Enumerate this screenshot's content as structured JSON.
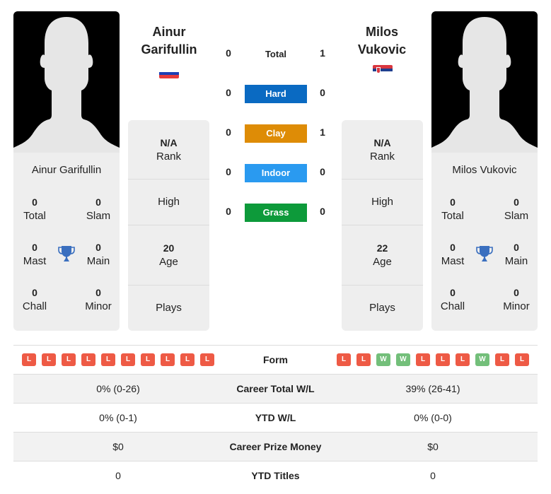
{
  "players": {
    "left": {
      "name_line1": "Ainur",
      "name_line2": "Garifullin",
      "full_name": "Ainur Garifullin",
      "flag": "russia-flag",
      "titles": {
        "total": {
          "value": "0",
          "label": "Total"
        },
        "slam": {
          "value": "0",
          "label": "Slam"
        },
        "mast": {
          "value": "0",
          "label": "Mast"
        },
        "main": {
          "value": "0",
          "label": "Main"
        },
        "chall": {
          "value": "0",
          "label": "Chall"
        },
        "minor": {
          "value": "0",
          "label": "Minor"
        }
      },
      "info": {
        "rank": {
          "value": "N/A",
          "label": "Rank"
        },
        "high": {
          "value": "",
          "label": "High"
        },
        "age": {
          "value": "20",
          "label": "Age"
        },
        "plays": {
          "value": "",
          "label": "Plays"
        }
      },
      "form": [
        "L",
        "L",
        "L",
        "L",
        "L",
        "L",
        "L",
        "L",
        "L",
        "L"
      ]
    },
    "right": {
      "name_line1": "Milos",
      "name_line2": "Vukovic",
      "full_name": "Milos Vukovic",
      "flag": "serbia-flag",
      "titles": {
        "total": {
          "value": "0",
          "label": "Total"
        },
        "slam": {
          "value": "0",
          "label": "Slam"
        },
        "mast": {
          "value": "0",
          "label": "Mast"
        },
        "main": {
          "value": "0",
          "label": "Main"
        },
        "chall": {
          "value": "0",
          "label": "Chall"
        },
        "minor": {
          "value": "0",
          "label": "Minor"
        }
      },
      "info": {
        "rank": {
          "value": "N/A",
          "label": "Rank"
        },
        "high": {
          "value": "",
          "label": "High"
        },
        "age": {
          "value": "22",
          "label": "Age"
        },
        "plays": {
          "value": "",
          "label": "Plays"
        }
      },
      "form": [
        "L",
        "L",
        "W",
        "W",
        "L",
        "L",
        "L",
        "W",
        "L",
        "L"
      ]
    }
  },
  "h2h": {
    "total": {
      "label": "Total",
      "left": "0",
      "right": "1"
    },
    "surfaces": [
      {
        "label": "Hard",
        "left": "0",
        "right": "0",
        "color": "#0a6ac2"
      },
      {
        "label": "Clay",
        "left": "0",
        "right": "1",
        "color": "#de8c06"
      },
      {
        "label": "Indoor",
        "left": "0",
        "right": "0",
        "color": "#2a9af0"
      },
      {
        "label": "Grass",
        "left": "0",
        "right": "0",
        "color": "#0d9a3a"
      }
    ]
  },
  "table": {
    "form_label": "Form",
    "rows": [
      {
        "label": "Career Total W/L",
        "left": "0% (0-26)",
        "right": "39% (26-41)"
      },
      {
        "label": "YTD W/L",
        "left": "0% (0-1)",
        "right": "0% (0-0)"
      },
      {
        "label": "Career Prize Money",
        "left": "$0",
        "right": "$0"
      },
      {
        "label": "YTD Titles",
        "left": "0",
        "right": "0"
      }
    ]
  },
  "colors": {
    "win": "#73bf7a",
    "loss": "#ee5a45",
    "trophy": "#3a6fbf"
  }
}
